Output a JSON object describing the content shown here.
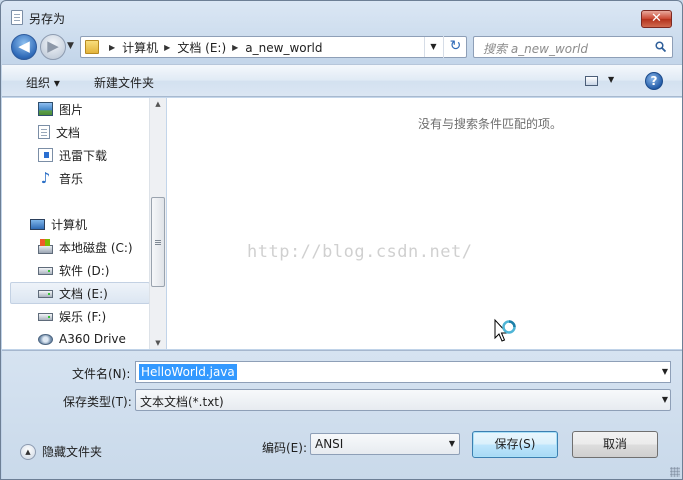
{
  "window": {
    "title": "另存为",
    "close_label": "✕"
  },
  "nav": {
    "back_icon": "◀",
    "forward_icon": "▶",
    "recent_icon": "▼",
    "refresh_icon": "↻"
  },
  "address": {
    "items": [
      "计算机",
      "文档 (E:)",
      "a_new_world"
    ],
    "separator": "▶",
    "dropdown": "▼"
  },
  "search": {
    "placeholder": "搜索 a_new_world"
  },
  "commandbar": {
    "organize_label": "组织 ▾",
    "new_folder_label": "新建文件夹",
    "view_dropdown": "▼",
    "help_label": "?"
  },
  "navpane": {
    "items": [
      {
        "label": "图片",
        "icon": "pictures-icon"
      },
      {
        "label": "文档",
        "icon": "documents-icon"
      },
      {
        "label": "迅雷下载",
        "icon": "download-folder-icon"
      },
      {
        "label": "音乐",
        "icon": "music-icon"
      },
      {
        "label": "计算机",
        "icon": "computer-icon"
      },
      {
        "label": "本地磁盘 (C:)",
        "icon": "system-drive-icon"
      },
      {
        "label": "软件 (D:)",
        "icon": "drive-icon"
      },
      {
        "label": "文档 (E:)",
        "icon": "drive-icon",
        "selected": true
      },
      {
        "label": "娱乐 (F:)",
        "icon": "drive-icon"
      },
      {
        "label": "A360 Drive",
        "icon": "cloud-drive-icon"
      }
    ],
    "scroll_up": "▲",
    "scroll_down": "▼"
  },
  "content": {
    "empty_message": "没有与搜索条件匹配的项。",
    "watermark": "http://blog.csdn.net/"
  },
  "form": {
    "filename_label": "文件名(N):",
    "filename_value": "HelloWorld.java",
    "filetype_label": "保存类型(T):",
    "filetype_value": "文本文档(*.txt)",
    "encoding_label": "编码(E):",
    "encoding_value": "ANSI",
    "hide_folders_label": "隐藏文件夹",
    "save_label": "保存(S)",
    "cancel_label": "取消",
    "combo_arrow": "▼",
    "hide_folders_arrow": "▲"
  },
  "colors": {
    "selection": "#3399ff",
    "accent": "#2f6ab8",
    "close": "#c9452f"
  }
}
